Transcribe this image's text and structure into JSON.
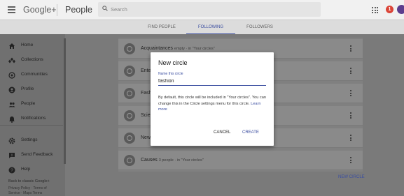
{
  "header": {
    "logo": "Google+",
    "app_name": "People",
    "search_placeholder": "Search",
    "notification_count": "1"
  },
  "tabs": [
    {
      "label": "FIND PEOPLE"
    },
    {
      "label": "FOLLOWING"
    },
    {
      "label": "FOLLOWERS"
    }
  ],
  "sidebar": {
    "items": [
      {
        "label": "Home",
        "icon": "home-icon"
      },
      {
        "label": "Collections",
        "icon": "collections-icon"
      },
      {
        "label": "Communities",
        "icon": "communities-icon"
      },
      {
        "label": "Profile",
        "icon": "profile-icon"
      },
      {
        "label": "People",
        "icon": "people-icon"
      },
      {
        "label": "Notifications",
        "icon": "bell-icon"
      },
      {
        "label": "Settings",
        "icon": "gear-icon"
      },
      {
        "label": "Send Feedback",
        "icon": "feedback-icon"
      },
      {
        "label": "Help",
        "icon": "help-icon"
      }
    ],
    "back_link": "Back to classic Google+",
    "footer": "Privacy Policy · Terms of Service · Maps Terms"
  },
  "circles": [
    {
      "name": "Acquaintances",
      "meta": "empty · in \"Your circles\""
    },
    {
      "name": "Ente",
      "meta": ""
    },
    {
      "name": "Fash",
      "meta": ""
    },
    {
      "name": "Scie",
      "meta": ""
    },
    {
      "name": "New",
      "meta": ""
    },
    {
      "name": "Causes",
      "meta": "3 people · in \"Your circles\""
    }
  ],
  "new_circle_label": "NEW CIRCLE",
  "dialog": {
    "title": "New circle",
    "field_label": "Name this circle",
    "field_value": "fashion",
    "body": "By default, this circle will be included in \"Your circles\". You can change this in the Circle settings menu for this circle.",
    "learn_more": "Learn more",
    "cancel_label": "CANCEL",
    "create_label": "CREATE"
  },
  "colors": {
    "accent": "#3b4ea0",
    "notification": "#db4437",
    "avatar": "#5d3d8e"
  }
}
